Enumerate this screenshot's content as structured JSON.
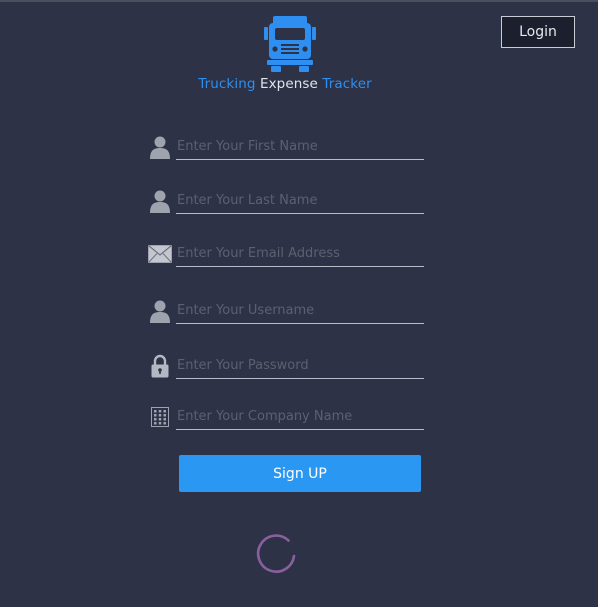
{
  "header": {
    "login_label": "Login"
  },
  "brand": {
    "word1": "Trucking",
    "word2": "Expense",
    "word3": "Tracker",
    "accent_color": "#2f8ff0",
    "logo_icon": "truck-icon"
  },
  "form": {
    "fields": [
      {
        "name": "first-name",
        "icon": "user-icon",
        "placeholder": "Enter Your First Name",
        "value": ""
      },
      {
        "name": "last-name",
        "icon": "user-icon",
        "placeholder": "Enter Your Last Name",
        "value": ""
      },
      {
        "name": "email",
        "icon": "envelope-icon",
        "placeholder": "Enter Your Email Address",
        "value": ""
      },
      {
        "name": "username",
        "icon": "user-icon",
        "placeholder": "Enter Your Username",
        "value": ""
      },
      {
        "name": "password",
        "icon": "lock-icon",
        "placeholder": "Enter Your Password",
        "value": ""
      },
      {
        "name": "company-name",
        "icon": "building-icon",
        "placeholder": "Enter Your Company Name",
        "value": ""
      }
    ],
    "submit_label": "Sign UP",
    "submit_color": "#2a97f2"
  },
  "status": {
    "loading_icon": "loading-spinner-icon"
  },
  "colors": {
    "background": "#2d3246",
    "spinner": "#8a5fa0"
  }
}
